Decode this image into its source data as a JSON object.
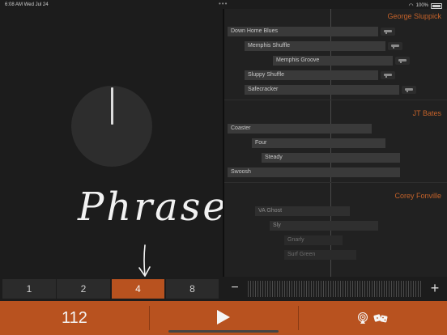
{
  "status_bar": {
    "time_date": "6:08 AM   Wed Jul 24",
    "battery": "100%"
  },
  "annotation": {
    "text": "Phrase"
  },
  "sections": [
    {
      "artist": "George Sluppick",
      "clips": [
        {
          "label": "Down Home Blues"
        },
        {
          "label": "Memphis Shuffle"
        },
        {
          "label": "Memphis Groove"
        },
        {
          "label": "Sluppy Shuffle"
        },
        {
          "label": "Safecracker"
        }
      ]
    },
    {
      "artist": "JT Bates",
      "clips": [
        {
          "label": "Coaster"
        },
        {
          "label": "Four"
        },
        {
          "label": "Steady"
        },
        {
          "label": "Swoosh"
        }
      ]
    },
    {
      "artist": "Corey Fonville",
      "clips": [
        {
          "label": "VA Ghost"
        },
        {
          "label": "Sly"
        },
        {
          "label": "Gnarly"
        },
        {
          "label": "Surf Green"
        }
      ]
    }
  ],
  "phrase_lengths": {
    "options": [
      "1",
      "2",
      "4",
      "8"
    ],
    "selected": "4"
  },
  "zoom": {
    "minus": "−",
    "plus": "+"
  },
  "transport": {
    "tempo": "112"
  },
  "icons": {
    "play": "play-icon",
    "airplay": "airplay-icon",
    "dice": "dice-icon",
    "fill_clip": "guitar-fill-icon"
  },
  "colors": {
    "accent": "#b8521f",
    "artist": "#c4622a"
  }
}
